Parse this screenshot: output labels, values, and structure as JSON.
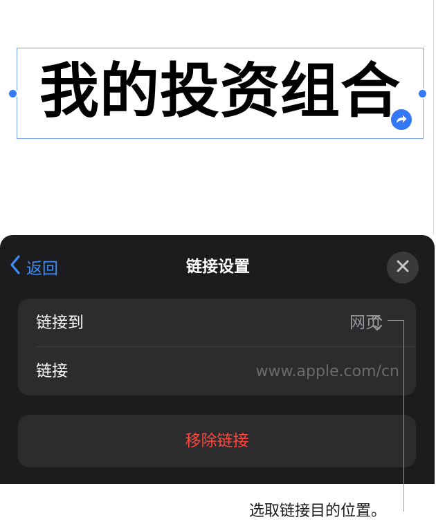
{
  "canvas": {
    "textbox_text": "我的投资组合"
  },
  "sheet": {
    "back_label": "返回",
    "title": "链接设置",
    "rows": [
      {
        "label": "链接到",
        "value": "网页"
      },
      {
        "label": "链接",
        "value": "www.apple.com/cn"
      }
    ],
    "remove_label": "移除链接"
  },
  "callout": {
    "text": "选取链接目的位置。"
  },
  "colors": {
    "accent": "#3478f6",
    "destructive": "#ff453a",
    "sheet_bg": "#1c1c1e",
    "group_bg": "#2c2c2e"
  },
  "icons": {
    "back": "chevron-left-icon",
    "close": "close-icon",
    "picker": "chevron-up-down-icon",
    "link_badge": "link-arrow-icon"
  }
}
